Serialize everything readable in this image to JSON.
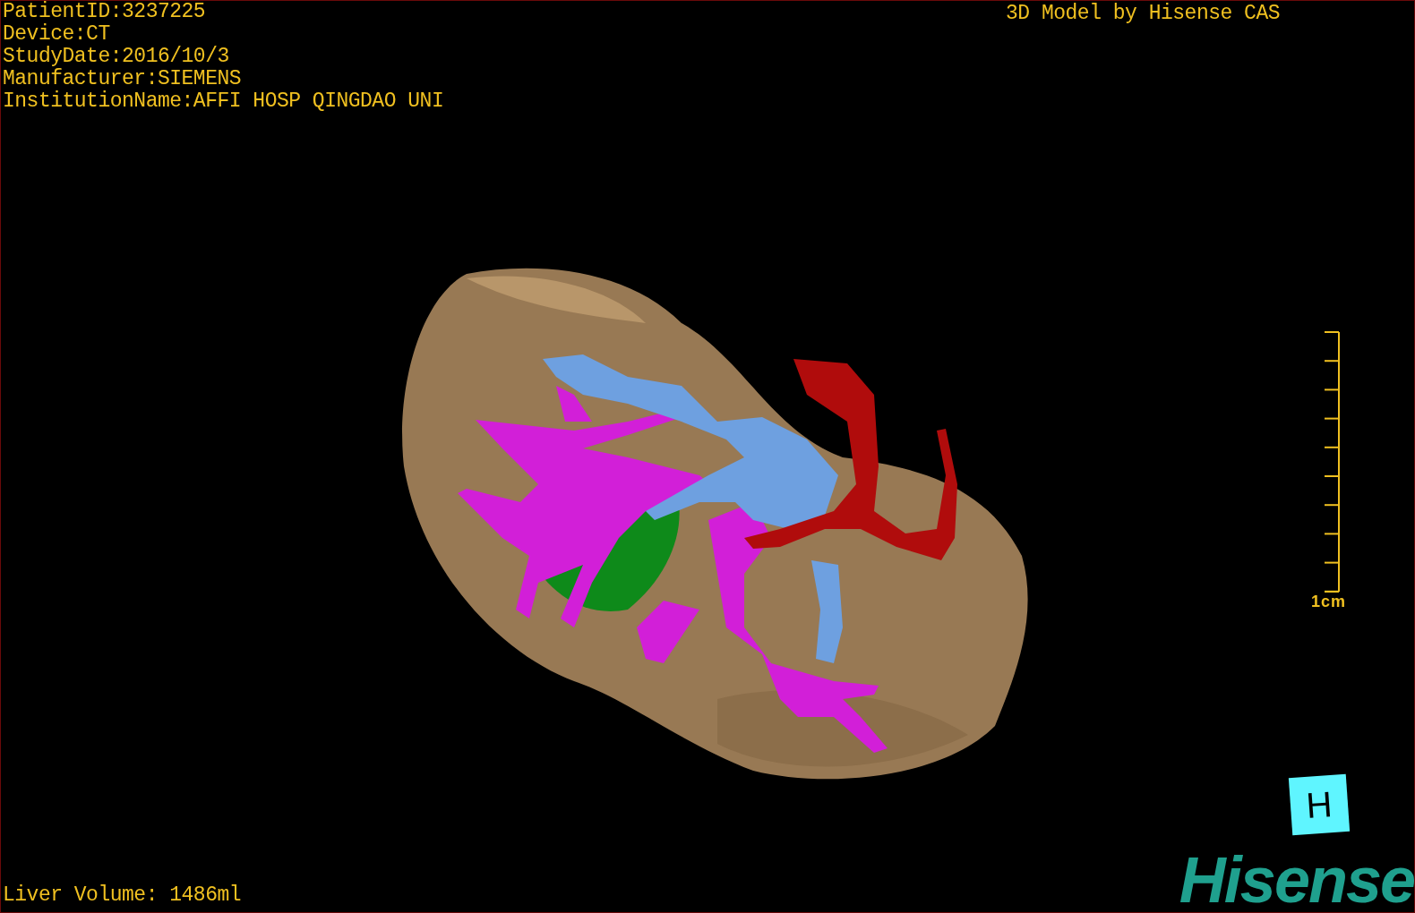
{
  "study_info": [
    "PatientID:3237225",
    "Device:CT",
    "StudyDate:2016/10/3",
    "Manufacturer:SIEMENS",
    "InstitutionName:AFFI HOSP QINGDAO UNI"
  ],
  "title": "3D Model by Hisense CAS",
  "scale": {
    "label": "1cm"
  },
  "orientation_marker": "H",
  "liver_volume": "Liver Volume: 1486ml",
  "logo": "Hisense"
}
